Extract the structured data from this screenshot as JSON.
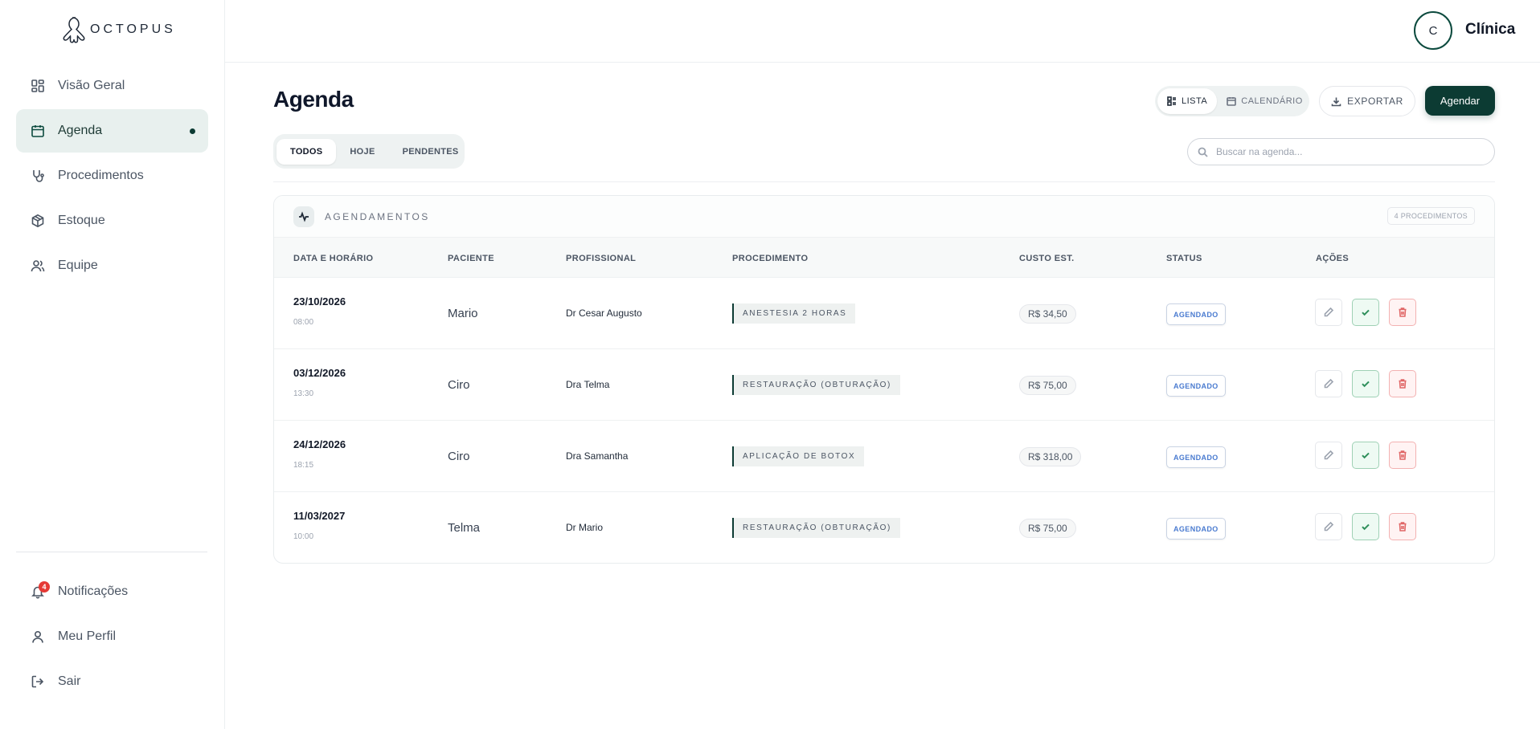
{
  "brand": {
    "logo_text": "OCTOPUS"
  },
  "sidebar": {
    "items": [
      {
        "label": "Visão Geral",
        "icon": "dashboard-icon"
      },
      {
        "label": "Agenda",
        "icon": "calendar-icon",
        "active": true
      },
      {
        "label": "Procedimentos",
        "icon": "stethoscope-icon"
      },
      {
        "label": "Estoque",
        "icon": "box-icon"
      },
      {
        "label": "Equipe",
        "icon": "users-icon"
      }
    ],
    "bottom": [
      {
        "label": "Notificações",
        "icon": "bell-icon",
        "badge": "4"
      },
      {
        "label": "Meu Perfil",
        "icon": "user-icon"
      },
      {
        "label": "Sair",
        "icon": "logout-icon"
      }
    ]
  },
  "topbar": {
    "avatar_initial": "C",
    "clinic_name": "Clínica"
  },
  "header": {
    "title": "Agenda",
    "view_list": "LISTA",
    "view_calendar": "CALENDÁRIO",
    "export": "EXPORTAR",
    "schedule": "Agendar"
  },
  "filters": {
    "all": "TODOS",
    "today": "HOJE",
    "pending": "PENDENTES"
  },
  "search": {
    "placeholder": "Buscar na agenda..."
  },
  "card": {
    "title": "AGENDAMENTOS",
    "count": "4 PROCEDIMENTOS",
    "columns": [
      "DATA E HORÁRIO",
      "PACIENTE",
      "PROFISSIONAL",
      "PROCEDIMENTO",
      "CUSTO EST.",
      "STATUS",
      "AÇÕES"
    ],
    "rows": [
      {
        "date": "23/10/2026",
        "time": "08:00",
        "patient": "Mario",
        "professional": "Dr Cesar Augusto",
        "procedure": "ANESTESIA 2 HORAS",
        "cost": "R$ 34,50",
        "status": "AGENDADO"
      },
      {
        "date": "03/12/2026",
        "time": "13:30",
        "patient": "Ciro",
        "professional": "Dra Telma",
        "procedure": "RESTAURAÇÃO (OBTURAÇÃO)",
        "cost": "R$ 75,00",
        "status": "AGENDADO"
      },
      {
        "date": "24/12/2026",
        "time": "18:15",
        "patient": "Ciro",
        "professional": "Dra Samantha",
        "procedure": "APLICAÇÃO DE BOTOX",
        "cost": "R$ 318,00",
        "status": "AGENDADO"
      },
      {
        "date": "11/03/2027",
        "time": "10:00",
        "patient": "Telma",
        "professional": "Dr Mario",
        "procedure": "RESTAURAÇÃO (OBTURAÇÃO)",
        "cost": "R$ 75,00",
        "status": "AGENDADO"
      }
    ]
  },
  "colors": {
    "primary": "#0c3b33",
    "status_blue": "#4a7bd0",
    "badge_red": "#e53935"
  }
}
